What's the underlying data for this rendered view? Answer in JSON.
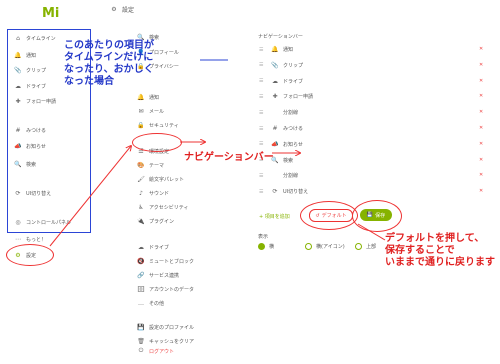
{
  "logo": "Mi",
  "header": {
    "icon": "gear-icon",
    "title": "設定"
  },
  "sidebar": {
    "items": [
      {
        "icon": "⌂",
        "label": "タイムライン"
      },
      {
        "icon": "🔔",
        "label": "通知"
      },
      {
        "icon": "📎",
        "label": "クリップ"
      },
      {
        "icon": "☁",
        "label": "ドライブ"
      },
      {
        "icon": "✚",
        "label": "フォロー申請"
      },
      {
        "icon": "#",
        "label": "みつける"
      },
      {
        "icon": "📣",
        "label": "お知らせ"
      },
      {
        "icon": "🔍",
        "label": "検索"
      },
      {
        "icon": "⟳",
        "label": "UI切り替え"
      },
      {
        "icon": "◎",
        "label": "コントロールパネル"
      }
    ],
    "more": "もっと！",
    "settings": "設定"
  },
  "settings_menu": {
    "search": "検索",
    "groups": [
      [
        {
          "icon": "👤",
          "label": "プロフィール"
        },
        {
          "icon": "🔒",
          "label": "プライバシー"
        }
      ],
      [
        {
          "icon": "🔔",
          "label": "通知"
        },
        {
          "icon": "✉",
          "label": "メール"
        },
        {
          "icon": "🔒",
          "label": "セキュリティ"
        }
      ],
      [
        {
          "icon": "☰",
          "label": "環境設定"
        },
        {
          "icon": "🎨",
          "label": "テーマ"
        },
        {
          "icon": "🖌",
          "label": "絵文字パレット"
        },
        {
          "icon": "♪",
          "label": "サウンド"
        },
        {
          "icon": "♿",
          "label": "アクセシビリティ"
        },
        {
          "icon": "🔌",
          "label": "プラグイン"
        }
      ],
      [
        {
          "icon": "☁",
          "label": "ドライブ"
        },
        {
          "icon": "🔇",
          "label": "ミュートとブロック"
        },
        {
          "icon": "🔗",
          "label": "サービス連携"
        },
        {
          "icon": "🗄",
          "label": "アカウントのデータ"
        },
        {
          "icon": "…",
          "label": "その他"
        }
      ],
      [
        {
          "icon": "💾",
          "label": "設定のプロファイル"
        },
        {
          "icon": "🗑",
          "label": "キャッシュをクリア"
        },
        {
          "icon": "⏻",
          "label": "ログアウト"
        }
      ]
    ]
  },
  "nav_bar": {
    "title": "ナビゲーションバー",
    "items": [
      {
        "icon": "🔔",
        "label": "通知"
      },
      {
        "icon": "📎",
        "label": "クリップ"
      },
      {
        "icon": "☁",
        "label": "ドライブ"
      },
      {
        "icon": "✚",
        "label": "フォロー申請"
      },
      {
        "icon": "",
        "label": "分割線"
      },
      {
        "icon": "#",
        "label": "みつける"
      },
      {
        "icon": "📣",
        "label": "お知らせ"
      },
      {
        "icon": "🔍",
        "label": "検索"
      },
      {
        "icon": "",
        "label": "分割線"
      },
      {
        "icon": "⟳",
        "label": "UI切り替え"
      }
    ],
    "add_item": "+ 項目を追加",
    "default_button": "デフォルト",
    "save_button": "保存",
    "display_label": "表示",
    "display_options": [
      "横",
      "横(アイコン)",
      "上部"
    ]
  },
  "annotations": {
    "blue_note": [
      "このあたりの項目が",
      "タイムラインだけに",
      "なったり、おかしく",
      "なった場合"
    ],
    "nav_note": "ナビゲーションバー",
    "default_note": [
      "デフォルトを押して、",
      "保存することで",
      "いままで通りに戻ります"
    ]
  },
  "colors": {
    "accent": "#86b300",
    "annotation_blue": "#2438c8",
    "annotation_red": "#e02020"
  }
}
